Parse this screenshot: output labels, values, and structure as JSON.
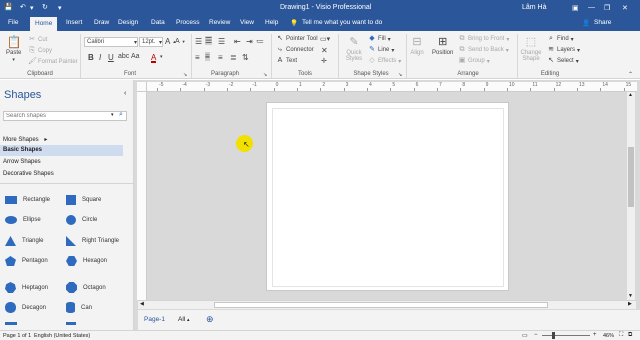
{
  "titlebar": {
    "title": "Drawing1  -  Visio Professional",
    "user": "Lâm Hà",
    "share": "Share",
    "tell_me": "Tell me what you want to do"
  },
  "tabs": [
    "File",
    "Home",
    "Insert",
    "Draw",
    "Design",
    "Data",
    "Process",
    "Review",
    "View",
    "Help"
  ],
  "ribbon": {
    "clipboard": {
      "paste": "Paste",
      "cut": "Cut",
      "copy": "Copy",
      "format_painter": "Format Painter",
      "label": "Clipboard"
    },
    "font": {
      "family": "Calibri",
      "size": "12pt.",
      "label": "Font"
    },
    "paragraph": {
      "label": "Paragraph"
    },
    "tools": {
      "pointer": "Pointer Tool",
      "connector": "Connector",
      "text": "Text",
      "label": "Tools"
    },
    "shape_styles": {
      "quick_styles": "Quick Styles",
      "fill": "Fill",
      "line": "Line",
      "effects": "Effects",
      "label": "Shape Styles"
    },
    "arrange": {
      "align": "Align",
      "position": "Position",
      "bring_front": "Bring to Front",
      "send_back": "Send to Back",
      "group": "Group",
      "label": "Arrange"
    },
    "editing": {
      "change_shape": "Change Shape",
      "find": "Find",
      "layers": "Layers",
      "select": "Select",
      "label": "Editing"
    }
  },
  "pane": {
    "title": "Shapes",
    "search_placeholder": "Search shapes",
    "more_shapes": "More Shapes",
    "stencils": [
      "Basic Shapes",
      "Arrow Shapes",
      "Decorative Shapes"
    ],
    "shapes": [
      "Rectangle",
      "Square",
      "Ellipse",
      "Circle",
      "Triangle",
      "Right Triangle",
      "Pentagon",
      "Hexagon",
      "Heptagon",
      "Octagon",
      "Decagon",
      "Can"
    ]
  },
  "ruler_ticks": [
    "-5",
    "-4",
    "-3",
    "-2",
    "-1",
    "0",
    "1",
    "2",
    "3",
    "4",
    "5",
    "6",
    "7",
    "8",
    "9",
    "10",
    "11",
    "12",
    "13",
    "14",
    "15"
  ],
  "pagetabs": {
    "page": "Page-1",
    "all": "All"
  },
  "status": {
    "page": "Page 1 of 1",
    "language": "English (United States)",
    "zoom": "46%"
  }
}
